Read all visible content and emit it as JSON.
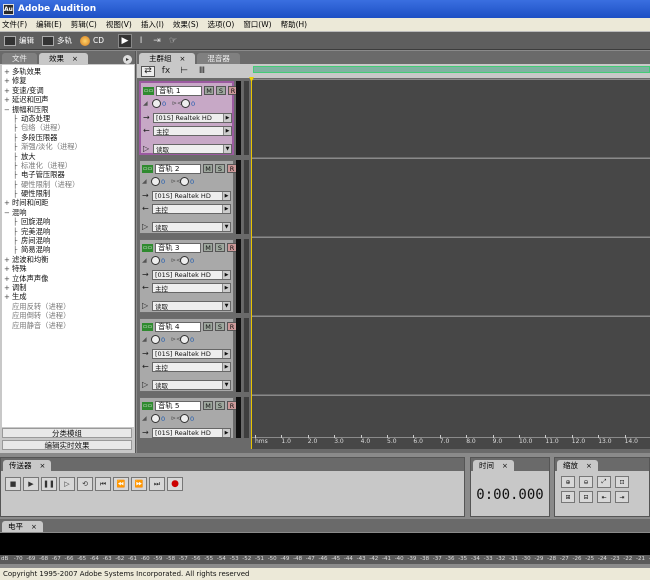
{
  "app": {
    "title": "Adobe Audition",
    "icon_label": "Au"
  },
  "menu": [
    "文件(F)",
    "编辑(E)",
    "剪辑(C)",
    "视图(V)",
    "插入(I)",
    "效果(S)",
    "选项(O)",
    "窗口(W)",
    "帮助(H)"
  ],
  "toolbar": {
    "edit_label": "编辑",
    "multitrack_label": "多轨",
    "cd_label": "CD"
  },
  "left_panel": {
    "tabs": [
      "文件",
      "效果"
    ],
    "tree": [
      {
        "label": "多轨效果",
        "level": 1,
        "pm": "+"
      },
      {
        "label": "修复",
        "level": 1,
        "pm": "+"
      },
      {
        "label": "变速/变调",
        "level": 1,
        "pm": "+"
      },
      {
        "label": "延迟和回声",
        "level": 1,
        "pm": "+"
      },
      {
        "label": "振幅和压限",
        "level": 1,
        "pm": "−"
      },
      {
        "label": "动态处理",
        "level": 2,
        "dim": false
      },
      {
        "label": "包络（进程）",
        "level": 2,
        "dim": true
      },
      {
        "label": "多段压限器",
        "level": 2,
        "dim": false
      },
      {
        "label": "渐强/淡化（进程）",
        "level": 2,
        "dim": true
      },
      {
        "label": "放大",
        "level": 2,
        "dim": false
      },
      {
        "label": "标准化（进程）",
        "level": 2,
        "dim": true
      },
      {
        "label": "电子管压限器",
        "level": 2,
        "dim": false
      },
      {
        "label": "硬性限制（进程）",
        "level": 2,
        "dim": true
      },
      {
        "label": "硬性限制",
        "level": 2,
        "dim": false
      },
      {
        "label": "时间和间距",
        "level": 1,
        "pm": "+"
      },
      {
        "label": "混响",
        "level": 1,
        "pm": "−"
      },
      {
        "label": "回旋混响",
        "level": 2,
        "dim": false
      },
      {
        "label": "完美混响",
        "level": 2,
        "dim": false
      },
      {
        "label": "房间混响",
        "level": 2,
        "dim": false
      },
      {
        "label": "简易混响",
        "level": 2,
        "dim": false
      },
      {
        "label": "滤波和均衡",
        "level": 1,
        "pm": "+"
      },
      {
        "label": "特殊",
        "level": 1,
        "pm": "+"
      },
      {
        "label": "立体声声像",
        "level": 1,
        "pm": "+"
      },
      {
        "label": "调制",
        "level": 1,
        "pm": "+"
      },
      {
        "label": "生成",
        "level": 1,
        "pm": "+"
      },
      {
        "label": "应用反转（进程）",
        "level": 1,
        "pm": " ",
        "dim": true
      },
      {
        "label": "应用倒转（进程）",
        "level": 1,
        "pm": " ",
        "dim": true
      },
      {
        "label": "应用静音（进程）",
        "level": 1,
        "pm": " ",
        "dim": true
      }
    ],
    "buttons": [
      "分类模组",
      "编辑实时效果"
    ]
  },
  "main_panel": {
    "tabs": [
      "主群组",
      "混音器"
    ],
    "tracks": [
      {
        "name": "音轨 1",
        "vol": "0",
        "pan": "0",
        "input": "[01S] Realtek HD",
        "output": "主控",
        "automation": "读取",
        "selected": true
      },
      {
        "name": "音轨 2",
        "vol": "0",
        "pan": "0",
        "input": "[01S] Realtek HD",
        "output": "主控",
        "automation": "读取",
        "selected": false
      },
      {
        "name": "音轨 3",
        "vol": "0",
        "pan": "0",
        "input": "[01S] Realtek HD",
        "output": "主控",
        "automation": "读取",
        "selected": false
      },
      {
        "name": "音轨 4",
        "vol": "0",
        "pan": "0",
        "input": "[01S] Realtek HD",
        "output": "主控",
        "automation": "读取",
        "selected": false
      },
      {
        "name": "音轨 5",
        "vol": "0",
        "pan": "0",
        "input": "[01S] Realtek HD",
        "output": "主控",
        "automation": "读取",
        "selected": false
      }
    ],
    "ruler": [
      "hms",
      "1.0",
      "2.0",
      "3.0",
      "4.0",
      "5.0",
      "6.0",
      "7.0",
      "8.0",
      "9.0",
      "10.0",
      "11.0",
      "12.0",
      "13.0",
      "14.0",
      "15"
    ]
  },
  "transport": {
    "tab": "传送器"
  },
  "time": {
    "tab": "时间",
    "value": "0:00.000"
  },
  "zoom": {
    "tab": "缩放"
  },
  "levels": {
    "tab": "电平",
    "scale": [
      "dB",
      "-70",
      "-69",
      "-68",
      "-67",
      "-66",
      "-65",
      "-64",
      "-63",
      "-62",
      "-61",
      "-60",
      "-59",
      "-58",
      "-57",
      "-56",
      "-55",
      "-54",
      "-53",
      "-52",
      "-51",
      "-50",
      "-49",
      "-48",
      "-47",
      "-46",
      "-45",
      "-44",
      "-43",
      "-42",
      "-41",
      "-40",
      "-39",
      "-38",
      "-37",
      "-36",
      "-35",
      "-34",
      "-33",
      "-32",
      "-31",
      "-30",
      "-29",
      "-28",
      "-27",
      "-26",
      "-25",
      "-24",
      "-23",
      "-22",
      "-21",
      "-20"
    ]
  },
  "status": "Copyright 1995-2007 Adobe Systems Incorporated. All rights reserved"
}
